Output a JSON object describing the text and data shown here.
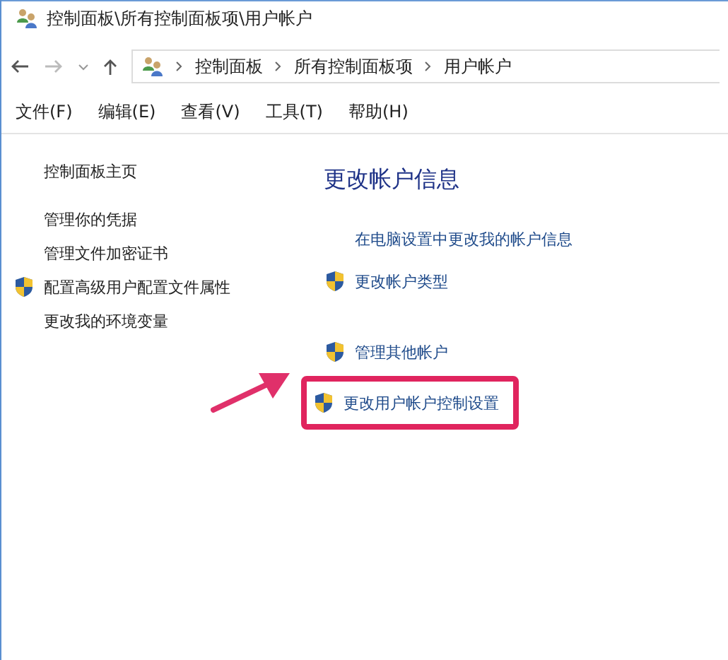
{
  "window": {
    "title": "控制面板\\所有控制面板项\\用户帐户"
  },
  "breadcrumb": [
    "控制面板",
    "所有控制面板项",
    "用户帐户"
  ],
  "menu": [
    "文件(F)",
    "编辑(E)",
    "查看(V)",
    "工具(T)",
    "帮助(H)"
  ],
  "sidebar": {
    "items": [
      {
        "label": "控制面板主页",
        "kind": "plain"
      },
      {
        "label": "管理你的凭据",
        "kind": "plain"
      },
      {
        "label": "管理文件加密证书",
        "kind": "plain"
      },
      {
        "label": "配置高级用户配置文件属性",
        "kind": "shield"
      },
      {
        "label": "更改我的环境变量",
        "kind": "plain"
      }
    ]
  },
  "main": {
    "heading": "更改帐户信息",
    "links": [
      {
        "label": "在电脑设置中更改我的帐户信息",
        "kind": "plain",
        "highlighted": false
      },
      {
        "label": "更改帐户类型",
        "kind": "shield",
        "highlighted": false
      },
      {
        "label": "管理其他帐户",
        "kind": "shield",
        "highlighted": false
      },
      {
        "label": "更改用户帐户控制设置",
        "kind": "shield",
        "highlighted": true
      }
    ]
  }
}
